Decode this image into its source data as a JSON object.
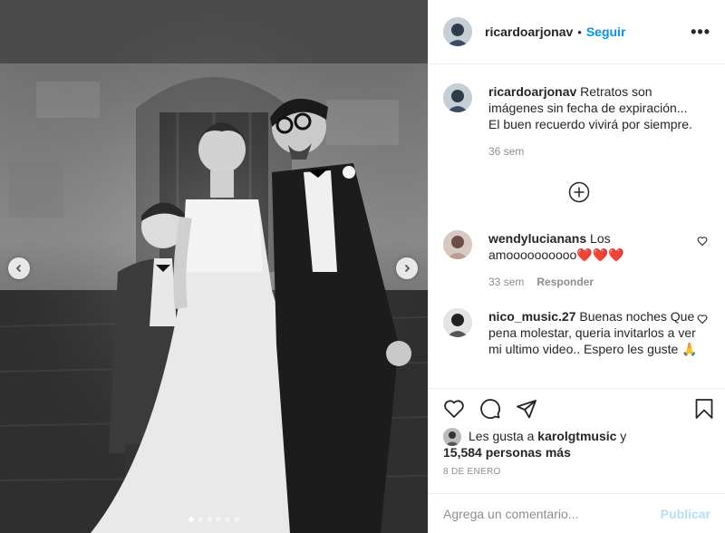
{
  "post": {
    "username": "ricardoarjonav",
    "separator": "•",
    "follow_label": "Seguir",
    "more_label": "•••"
  },
  "caption": {
    "username": "ricardoarjonav",
    "text": " Retratos son imágenes sin fecha de expiración... El buen recuerdo vivirá por siempre.",
    "time": "36 sem"
  },
  "comments": [
    {
      "username": "wendylucianans",
      "text": " Los amoooooooooo❤️❤️❤️",
      "time": "33 sem",
      "reply_label": "Responder"
    },
    {
      "username": "nico_music.27",
      "text": " Buenas noches Que pena molestar, queria invitarlos a ver mi ultimo video.. Espero les guste 🙏"
    }
  ],
  "likes": {
    "prefix": "Les gusta a ",
    "liker": "karolgtmusic",
    "middle": " y",
    "count_text": "15,584 personas más"
  },
  "date": "8 DE ENERO",
  "add_comment": {
    "placeholder": "Agrega un comentario...",
    "publish_label": "Publicar"
  },
  "carousel": {
    "dots": 6,
    "active": 0
  },
  "colors": {
    "accent": "#0095f6",
    "publish_disabled": "#b2dffc",
    "muted": "#8e8e8e",
    "border": "#efefef"
  },
  "icons": [
    "chevron-left-icon",
    "chevron-right-icon",
    "more-icon",
    "add-comments-icon",
    "heart-icon",
    "comment-icon",
    "share-icon",
    "bookmark-icon"
  ]
}
